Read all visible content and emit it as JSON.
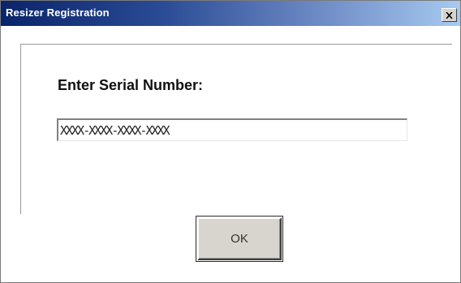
{
  "window": {
    "title": "Resizer Registration",
    "close_icon": "close-icon"
  },
  "form": {
    "prompt_label": "Enter Serial Number:",
    "serial_value": "XXXX-XXXX-XXXX-XXXX"
  },
  "buttons": {
    "ok_label": "OK"
  },
  "colors": {
    "titlebar_start": "#0a246a",
    "titlebar_end": "#a6caf0",
    "button_face": "#d8d5cf"
  }
}
